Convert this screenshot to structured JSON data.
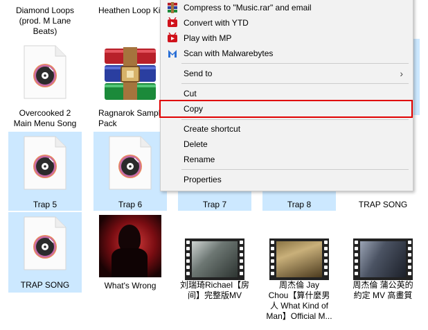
{
  "files": [
    {
      "label": "Diamond Loops\n(prod. M Lane\nBeats)",
      "icon": "music-file-icon"
    },
    {
      "label": "Heathen Loop Ki",
      "icon": "music-file-icon"
    },
    {
      "label": "Overcooked 2\nMain Menu Song",
      "icon": "music-file-icon"
    },
    {
      "label": "Ragnarok Sampl\nPack",
      "icon": "winrar-archive-icon"
    },
    {
      "label": "Trap 5",
      "icon": "music-file-icon"
    },
    {
      "label": "Trap 6",
      "icon": "music-file-icon"
    },
    {
      "label": "Trap 7",
      "icon": "music-file-icon"
    },
    {
      "label": "Trap 8",
      "icon": "music-file-icon"
    },
    {
      "label": "TRAP SONG",
      "icon": "music-file-icon"
    },
    {
      "label": "TRAP SONG",
      "icon": "music-file-icon"
    },
    {
      "label": "What's Wrong",
      "icon": "album-art-thumbnail"
    },
    {
      "label": "刘瑞琦Richael【房\n间】完整版MV",
      "icon": "video-thumbnail"
    },
    {
      "label": "周杰倫 Jay\nChou【算什麼男\n人 What Kind of\nMan】Official M...",
      "icon": "video-thumbnail"
    },
    {
      "label": "周杰倫 蒲公英的\n約定 MV 高畫質",
      "icon": "video-thumbnail"
    }
  ],
  "menu": {
    "items": [
      {
        "label": "Compress to \"Music.rar\" and email",
        "icon": "winrar-icon"
      },
      {
        "label": "Convert with YTD",
        "icon": "ytd-icon"
      },
      {
        "label": "Play with MP",
        "icon": "mp-icon"
      },
      {
        "label": "Scan with Malwarebytes",
        "icon": "malwarebytes-icon"
      },
      {
        "label": "Send to",
        "icon": "submenu-arrow-icon"
      },
      {
        "label": "Cut"
      },
      {
        "label": "Copy"
      },
      {
        "label": "Create shortcut"
      },
      {
        "label": "Delete"
      },
      {
        "label": "Rename"
      },
      {
        "label": "Properties"
      }
    ],
    "highlight_color": "#e00000"
  },
  "colors": {
    "selection": "#cce8ff",
    "menu_bg": "#f2f2f2"
  }
}
